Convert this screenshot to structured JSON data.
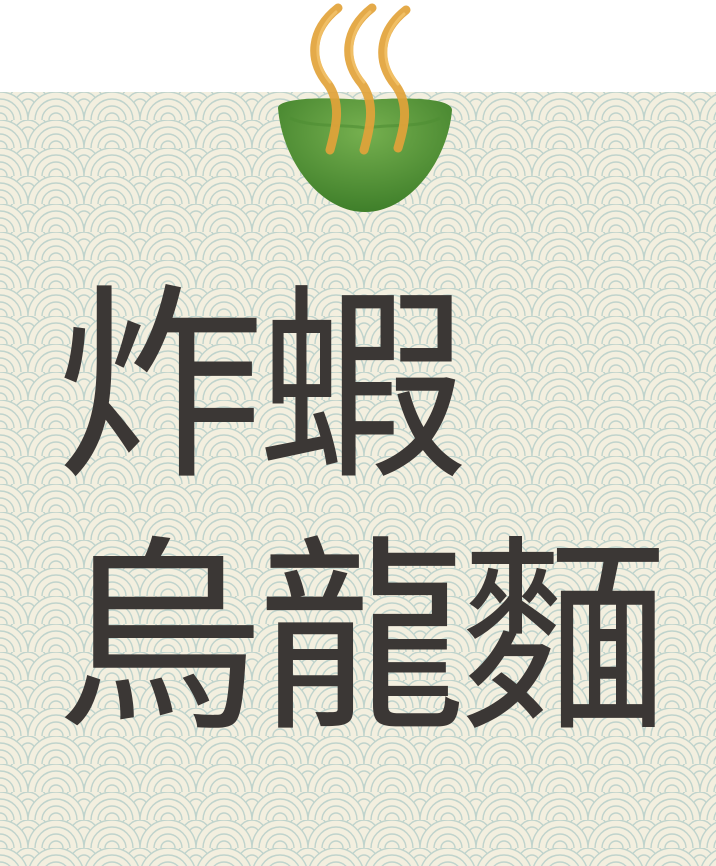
{
  "colors": {
    "background": "#f3efdf",
    "pattern_stroke": "#bfd3cc",
    "title_text": "#3b3735",
    "bowl_green": "#5b9a3c",
    "steam_gold": "#e2a33a"
  },
  "logo": {
    "icon": "steaming-bowl-icon"
  },
  "title": {
    "line1": "炸蝦",
    "line2": "烏龍麵"
  }
}
